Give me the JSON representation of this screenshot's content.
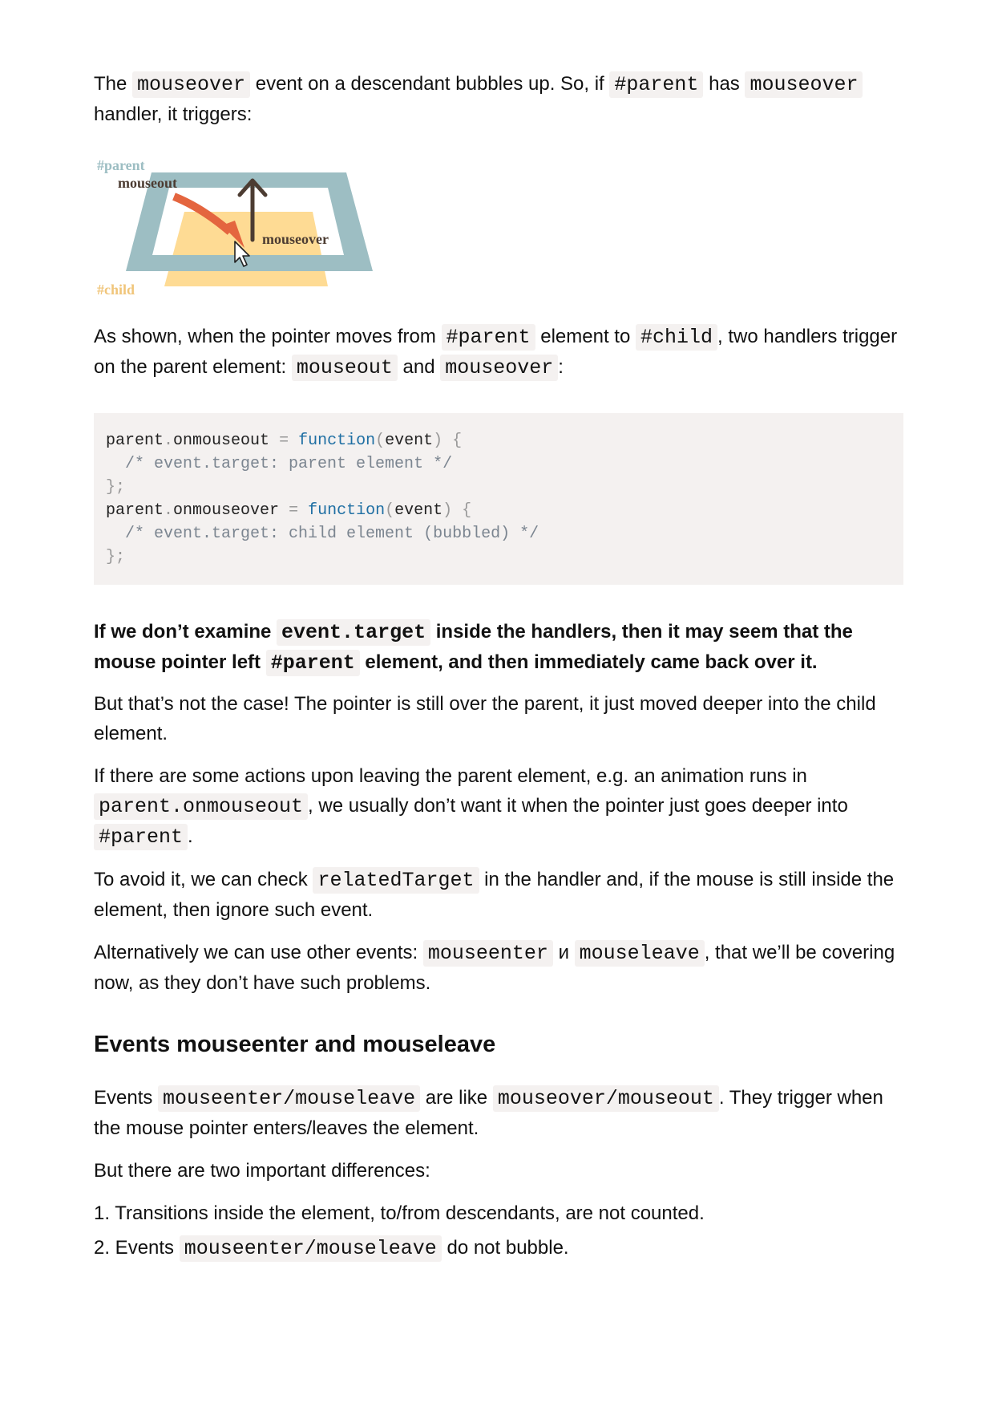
{
  "p1": {
    "t1": "The ",
    "c1": "mouseover",
    "t2": " event on a descendant bubbles up. So, if ",
    "c2": "#parent",
    "t3": " has ",
    "c3": "mouseover",
    "t4": " handler, it triggers:"
  },
  "diagram": {
    "parent_label": "#parent",
    "mouseout_label": "mouseout",
    "mouseover_label": "mouseover",
    "child_label": "#child",
    "colors": {
      "parent": "#9dbec3",
      "child": "#fedb94",
      "arrow_out": "#e4653f",
      "arrow_up": "#4c3c32",
      "parent_label": "#9dbec3",
      "child_label": "#f0c57a"
    }
  },
  "p2": {
    "t1": "As shown, when the pointer moves from ",
    "c1": "#parent",
    "t2": " element to ",
    "c2": "#child",
    "t3": ", two handlers trigger on the parent element: ",
    "c3": "mouseout",
    "t4": " and ",
    "c4": "mouseover",
    "t5": ":"
  },
  "code": {
    "l1_obj": "parent",
    "l1_dot": ".",
    "l1_prop": "onmouseout",
    "l1_eq": " = ",
    "l1_kw": "function",
    "l1_p1": "(",
    "l1_arg": "event",
    "l1_p2": ") {",
    "l2": "  /* event.target: parent element */",
    "l3": "};",
    "l4_obj": "parent",
    "l4_dot": ".",
    "l4_prop": "onmouseover",
    "l4_eq": " = ",
    "l4_kw": "function",
    "l4_p1": "(",
    "l4_arg": "event",
    "l4_p2": ") {",
    "l5": "  /* event.target: child element (bubbled) */",
    "l6": "};"
  },
  "p3": {
    "t1": "If we don’t examine ",
    "c1": "event.target",
    "t2": " inside the handlers, then it may seem that the mouse pointer left ",
    "c2": "#parent",
    "t3": " element, and then immediately came back over it."
  },
  "p4": {
    "t1": "But that’s not the case! The pointer is still over the parent, it just moved deeper into the child element."
  },
  "p5": {
    "t1": "If there are some actions upon leaving the parent element, e.g. an animation runs in ",
    "c1": "parent.onmouseout",
    "t2": ", we usually don’t want it when the pointer just goes deeper into ",
    "c2": "#parent",
    "t3": "."
  },
  "p6": {
    "t1": "To avoid it, we can check ",
    "c1": "relatedTarget",
    "t2": " in the handler and, if the mouse is still inside the element, then ignore such event."
  },
  "p7": {
    "t1": "Alternatively we can use other events: ",
    "c1": "mouseenter",
    "t2": " и ",
    "c2": "mouseleave",
    "t3": ", that we’ll be covering now, as they don’t have such problems."
  },
  "heading": "Events mouseenter and mouseleave",
  "p8": {
    "t1": "Events ",
    "c1": "mouseenter/mouseleave",
    "t2": " are like ",
    "c2": "mouseover/mouseout",
    "t3": ". They trigger when the mouse pointer enters/leaves the element."
  },
  "p9": {
    "t1": "But there are two important differences:"
  },
  "list": {
    "i1": "1. Transitions inside the element, to/from descendants, are not counted.",
    "i2_t1": "2. Events ",
    "i2_c1": "mouseenter/mouseleave",
    "i2_t2": " do not bubble."
  }
}
